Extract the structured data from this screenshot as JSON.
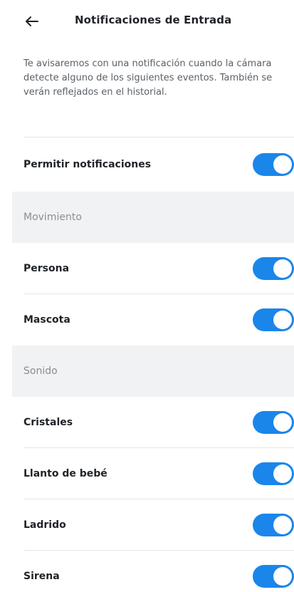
{
  "header": {
    "title": "Notificaciones de Entrada"
  },
  "description": "Te avisaremos con una notificación cuando la cámara detecte alguno de los siguientes eventos. También se verán reflejados en el historial.",
  "main_toggle": {
    "label": "Permitir notificaciones",
    "enabled": true
  },
  "sections": [
    {
      "title": "Movimiento",
      "items": [
        {
          "label": "Persona",
          "enabled": true
        },
        {
          "label": "Mascota",
          "enabled": true
        }
      ]
    },
    {
      "title": "Sonido",
      "items": [
        {
          "label": "Cristales",
          "enabled": true
        },
        {
          "label": "Llanto de bebé",
          "enabled": true
        },
        {
          "label": "Ladrido",
          "enabled": true
        },
        {
          "label": "Sirena",
          "enabled": true
        }
      ]
    }
  ],
  "colors": {
    "accent": "#1a86ea",
    "section_bg": "#f1f2f3",
    "text": "#1f2328",
    "muted": "#5b6168"
  },
  "icons": {
    "back": "arrow-left-icon"
  }
}
